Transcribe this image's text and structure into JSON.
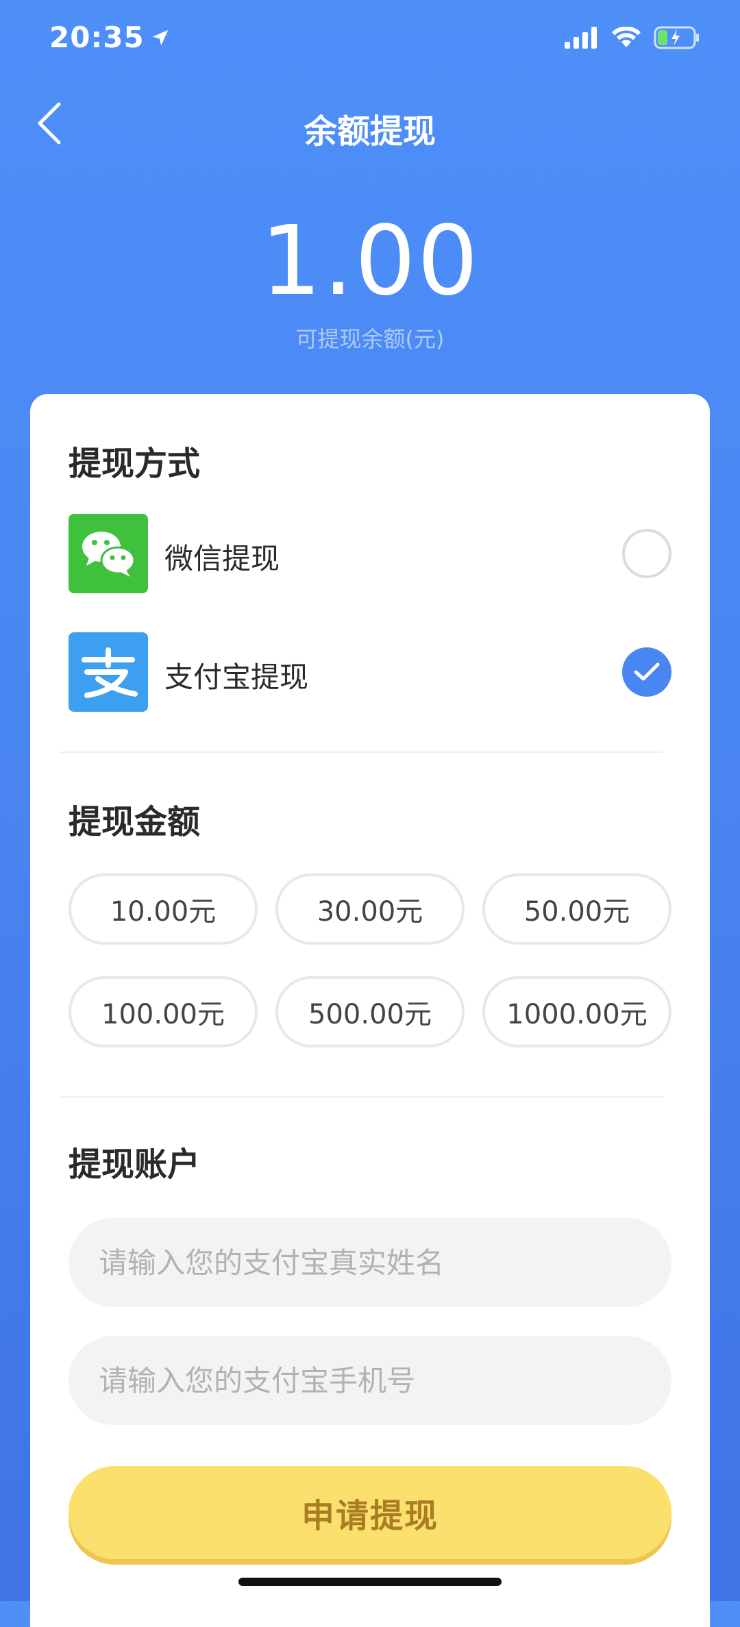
{
  "status_bar": {
    "time": "20:35"
  },
  "nav": {
    "title": "余额提现"
  },
  "balance": {
    "amount": "1.00",
    "label": "可提现余额(元)"
  },
  "method_section": {
    "title": "提现方式",
    "options": [
      {
        "label": "微信提现",
        "selected": false
      },
      {
        "label": "支付宝提现",
        "selected": true
      }
    ]
  },
  "amount_section": {
    "title": "提现金额",
    "options": [
      "10.00元",
      "30.00元",
      "50.00元",
      "100.00元",
      "500.00元",
      "1000.00元"
    ]
  },
  "account_section": {
    "title": "提现账户",
    "name_placeholder": "请输入您的支付宝真实姓名",
    "phone_placeholder": "请输入您的支付宝手机号"
  },
  "submit": {
    "label": "申请提现"
  },
  "colors": {
    "primary_blue": "#4a86f2",
    "wechat_green": "#3fc13d",
    "alipay_blue": "#3d9ff0",
    "submit_yellow": "#fbe06d",
    "submit_text": "#a97d23"
  }
}
